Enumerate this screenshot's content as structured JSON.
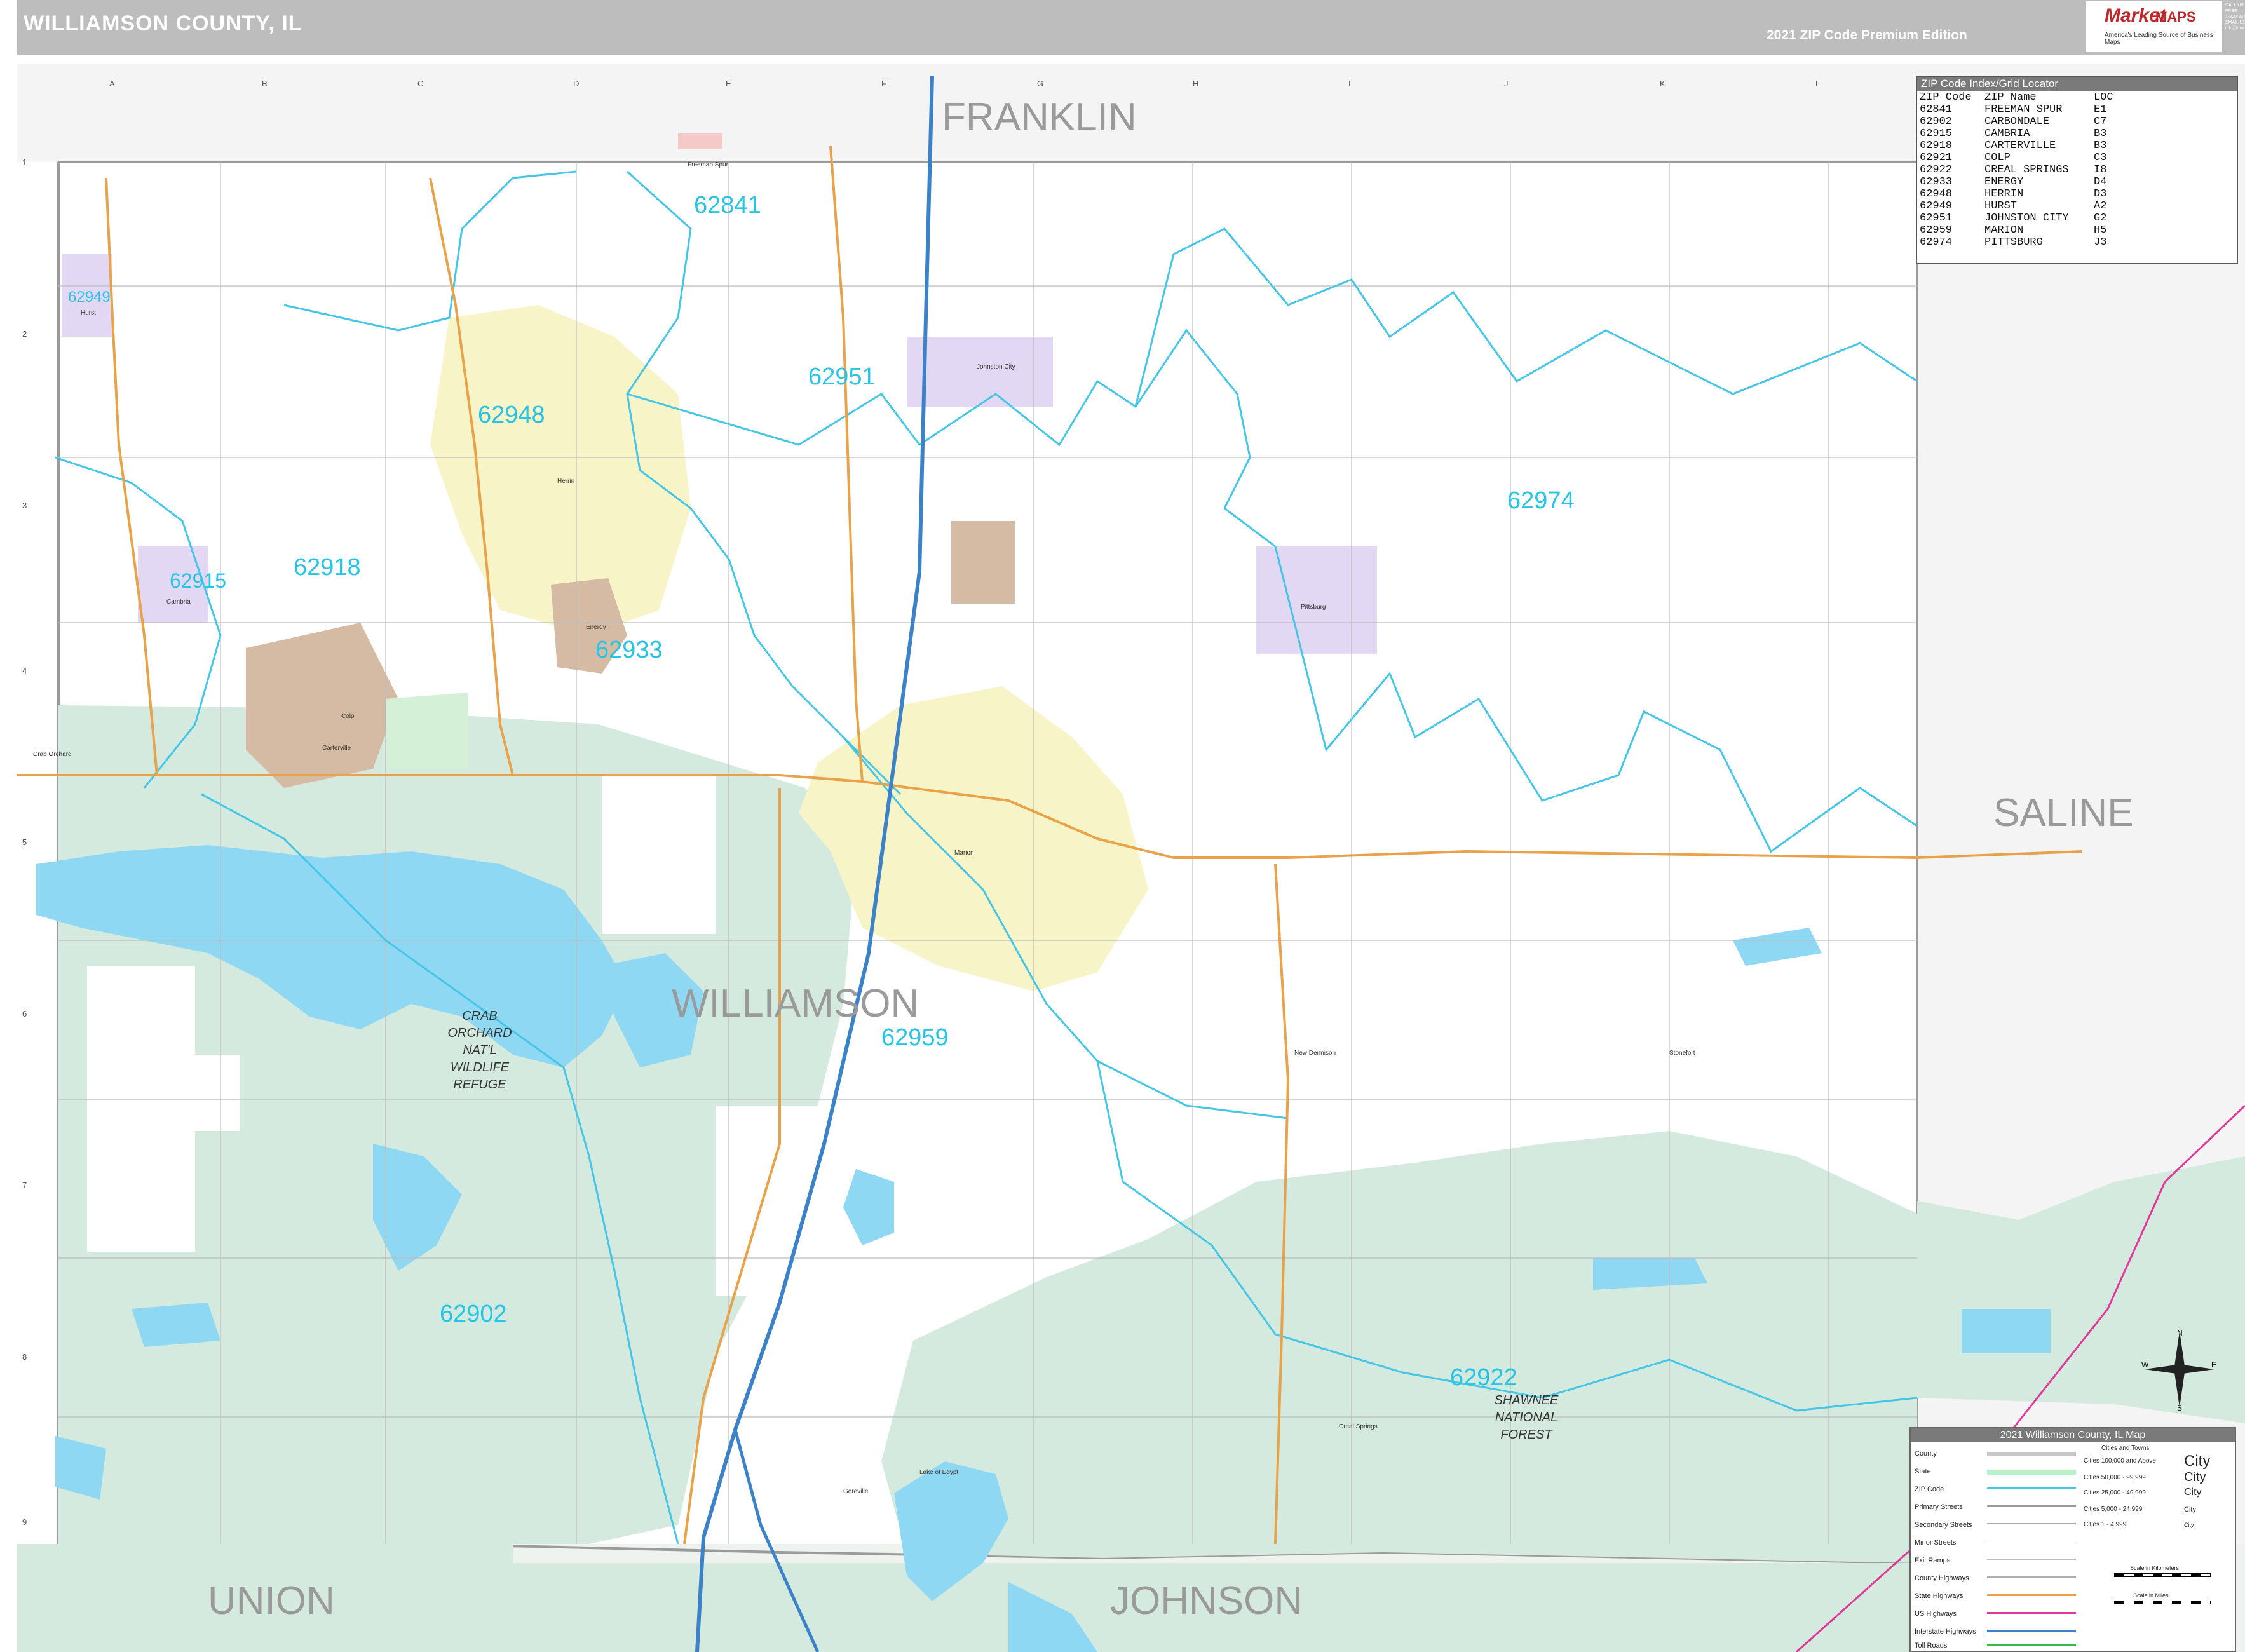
{
  "header": {
    "title": "WILLIAMSON COUNTY, IL",
    "edition": "2021 ZIP Code Premium Edition",
    "logo_market": "Market",
    "logo_maps": "MAPS",
    "logo_tagline": "America's Leading Source of Business Maps",
    "contact": [
      "CALL US TOLL FREE",
      "1-800-334-6277",
      "EMAIL US AT",
      "info@marketmaps.com"
    ]
  },
  "colors": {
    "header_gray": "#bdbdbd",
    "forest_green": "#d4eadf",
    "water_blue": "#8fd8f3",
    "zip_label": "#27c4e6",
    "zip_boundary": "#45c6e6",
    "state_highway": "#e8a24a",
    "interstate": "#3b82c8",
    "us_highway": "#e0379a",
    "neighbor_fill": "#f4f4f4",
    "urban_yellow": "#f7f4c8",
    "urban_tan": "#d5bba3",
    "urban_purple": "#e3d8f4",
    "urban_green": "#d4f0d7"
  },
  "map": {
    "county_label": "WILLIAMSON",
    "neighbors": [
      "FRANKLIN",
      "SALINE",
      "UNION",
      "JOHNSON"
    ],
    "zip_labels": [
      "62841",
      "62949",
      "62951",
      "62948",
      "62974",
      "62915",
      "62918",
      "62933",
      "62959",
      "62902",
      "62922"
    ],
    "forest_labels": {
      "crab_orchard": [
        "CRAB",
        "ORCHARD",
        "NAT'L",
        "WILDLIFE",
        "REFUGE"
      ],
      "shawnee": [
        "SHAWNEE",
        "NATIONAL",
        "FOREST"
      ]
    },
    "grid_columns": [
      "A",
      "B",
      "C",
      "D",
      "E",
      "F",
      "G",
      "H",
      "I",
      "J",
      "K",
      "L"
    ],
    "grid_rows": [
      "1",
      "2",
      "3",
      "4",
      "5",
      "6",
      "7",
      "8",
      "9"
    ],
    "towns": [
      "Freeman Spur",
      "Hurst",
      "Herrin",
      "Johnston City",
      "Carterville",
      "Energy",
      "Marion",
      "Creal Springs",
      "Crab Orchard",
      "Pittsburg",
      "Cambria",
      "Colp",
      "Stonefort",
      "New Dennison",
      "Lake of Egypt",
      "Goreville"
    ]
  },
  "zip_index": {
    "title": "ZIP Code Index/Grid Locator",
    "headers": [
      "ZIP Code",
      "ZIP Name",
      "LOC"
    ],
    "rows": [
      [
        "62841",
        "FREEMAN SPUR",
        "E1"
      ],
      [
        "62902",
        "CARBONDALE",
        "C7"
      ],
      [
        "62915",
        "CAMBRIA",
        "B3"
      ],
      [
        "62918",
        "CARTERVILLE",
        "B3"
      ],
      [
        "62921",
        "COLP",
        "C3"
      ],
      [
        "62922",
        "CREAL SPRINGS",
        "I8"
      ],
      [
        "62933",
        "ENERGY",
        "D4"
      ],
      [
        "62948",
        "HERRIN",
        "D3"
      ],
      [
        "62949",
        "HURST",
        "A2"
      ],
      [
        "62951",
        "JOHNSTON CITY",
        "G2"
      ],
      [
        "62959",
        "MARION",
        "H5"
      ],
      [
        "62974",
        "PITTSBURG",
        "J3"
      ]
    ]
  },
  "map_key": {
    "title": "2021 Williamson County, IL Map",
    "items": [
      "County",
      "State",
      "ZIP Code",
      "Primary Streets",
      "Secondary Streets",
      "Minor Streets",
      "Exit Ramps",
      "County Highways",
      "State Highways",
      "US Highways",
      "Interstate Highways",
      "Toll Roads"
    ],
    "cities_title": "Cities and Towns",
    "cities": [
      {
        "range": "Cities 100,000 and Above",
        "sym": "City"
      },
      {
        "range": "Cities 50,000 - 99,999",
        "sym": "City"
      },
      {
        "range": "Cities 25,000 - 49,999",
        "sym": "City"
      },
      {
        "range": "Cities 5,000 - 24,999",
        "sym": "City"
      },
      {
        "range": "Cities 1 - 4,999",
        "sym": "City"
      }
    ],
    "scale_km": "Scale in Kilometers",
    "scale_mi": "Scale in Miles"
  },
  "compass": {
    "n": "N",
    "s": "S",
    "e": "E",
    "w": "W"
  }
}
